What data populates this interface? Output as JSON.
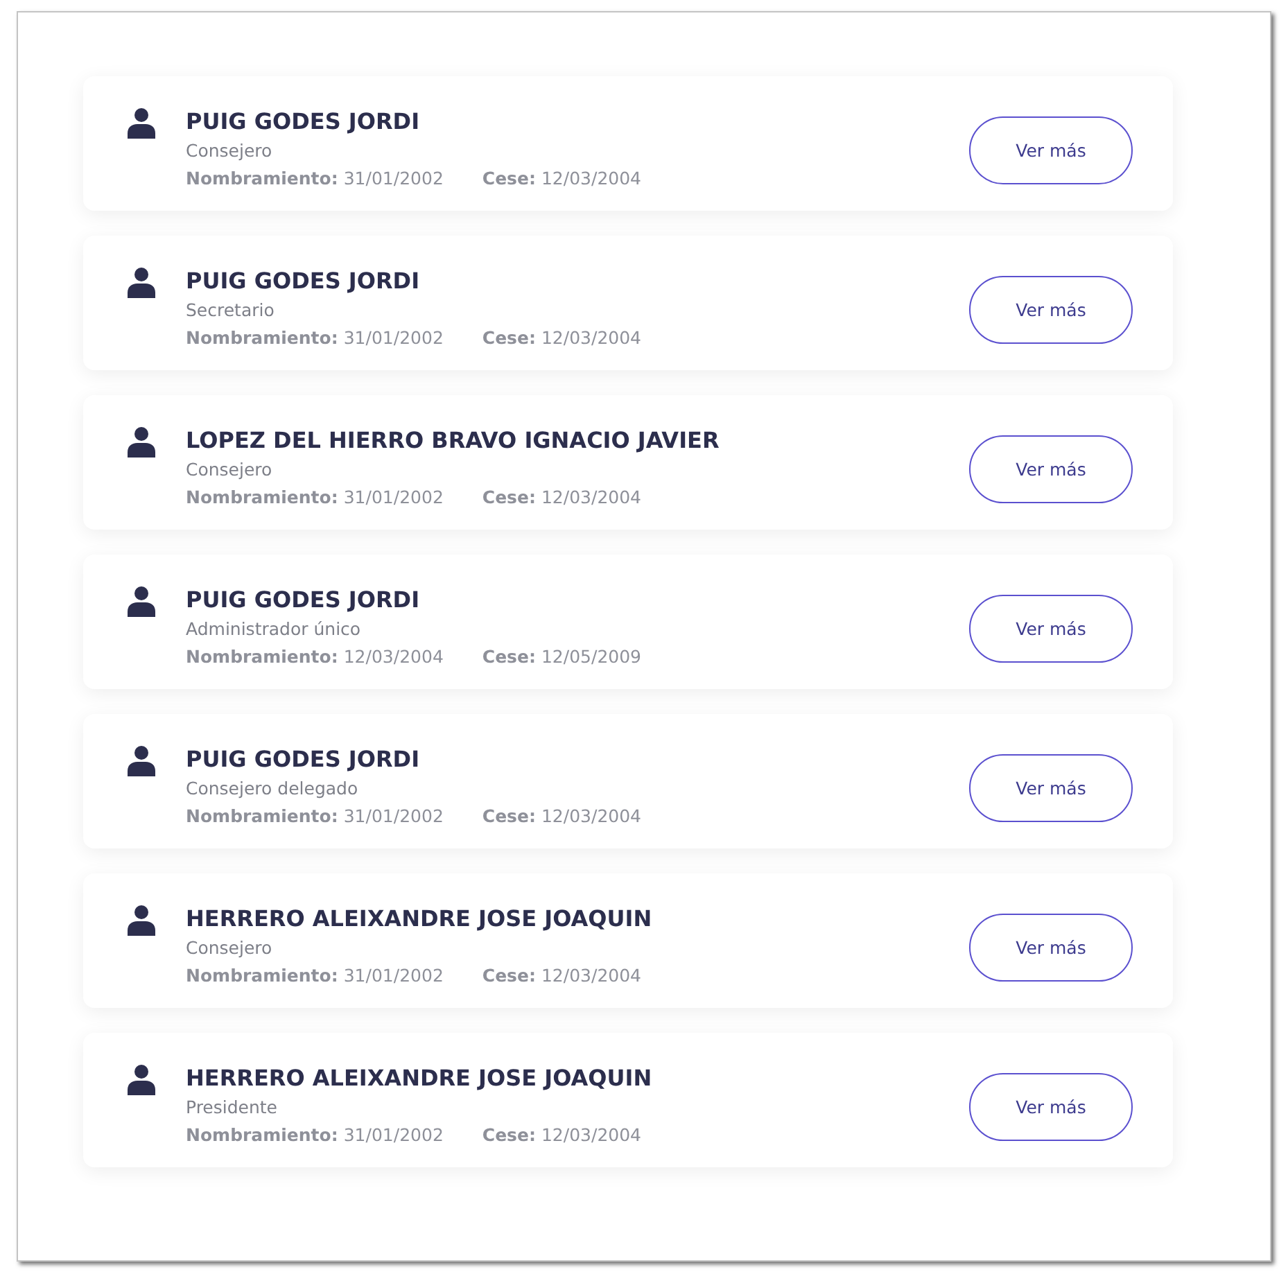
{
  "appointments": [
    {
      "name": "PUIG GODES JORDI",
      "role": "Consejero",
      "appointed": "**Nombramiento:** 31/01/2002",
      "ceased": "**Cese:** 12/03/2004",
      "button": "Ver más"
    },
    {
      "name": "PUIG GODES JORDI",
      "role": "Secretario",
      "appointed": "**Nombramiento:** 31/01/2002",
      "ceased": "**Cese:** 12/03/2004",
      "button": "Ver más"
    },
    {
      "name": "LOPEZ DEL HIERRO BRAVO IGNACIO JAVIER",
      "role": "Consejero",
      "appointed": "**Nombramiento:** 31/01/2002",
      "ceased": "**Cese:** 12/03/2004",
      "button": "Ver más"
    },
    {
      "name": "PUIG GODES JORDI",
      "role": "Administrador único",
      "appointed": "**Nombramiento:** 12/03/2004",
      "ceased": "**Cese:** 12/05/2009",
      "button": "Ver más"
    },
    {
      "name": "PUIG GODES JORDI",
      "role": "Consejero delegado",
      "appointed": "**Nombramiento:** 31/01/2002",
      "ceased": "**Cese:** 12/03/2004",
      "button": "Ver más"
    },
    {
      "name": "HERRERO ALEIXANDRE JOSE JOAQUIN",
      "role": "Consejero",
      "appointed": "**Nombramiento:** 31/01/2002",
      "ceased": "**Cese:** 12/03/2004",
      "button": "Ver más"
    },
    {
      "name": "HERRERO ALEIXANDRE JOSE JOAQUIN",
      "role": "Presidente",
      "appointed": "**Nombramiento:** 31/01/2002",
      "ceased": "**Cese:** 12/03/2004",
      "button": "Ver más"
    }
  ]
}
